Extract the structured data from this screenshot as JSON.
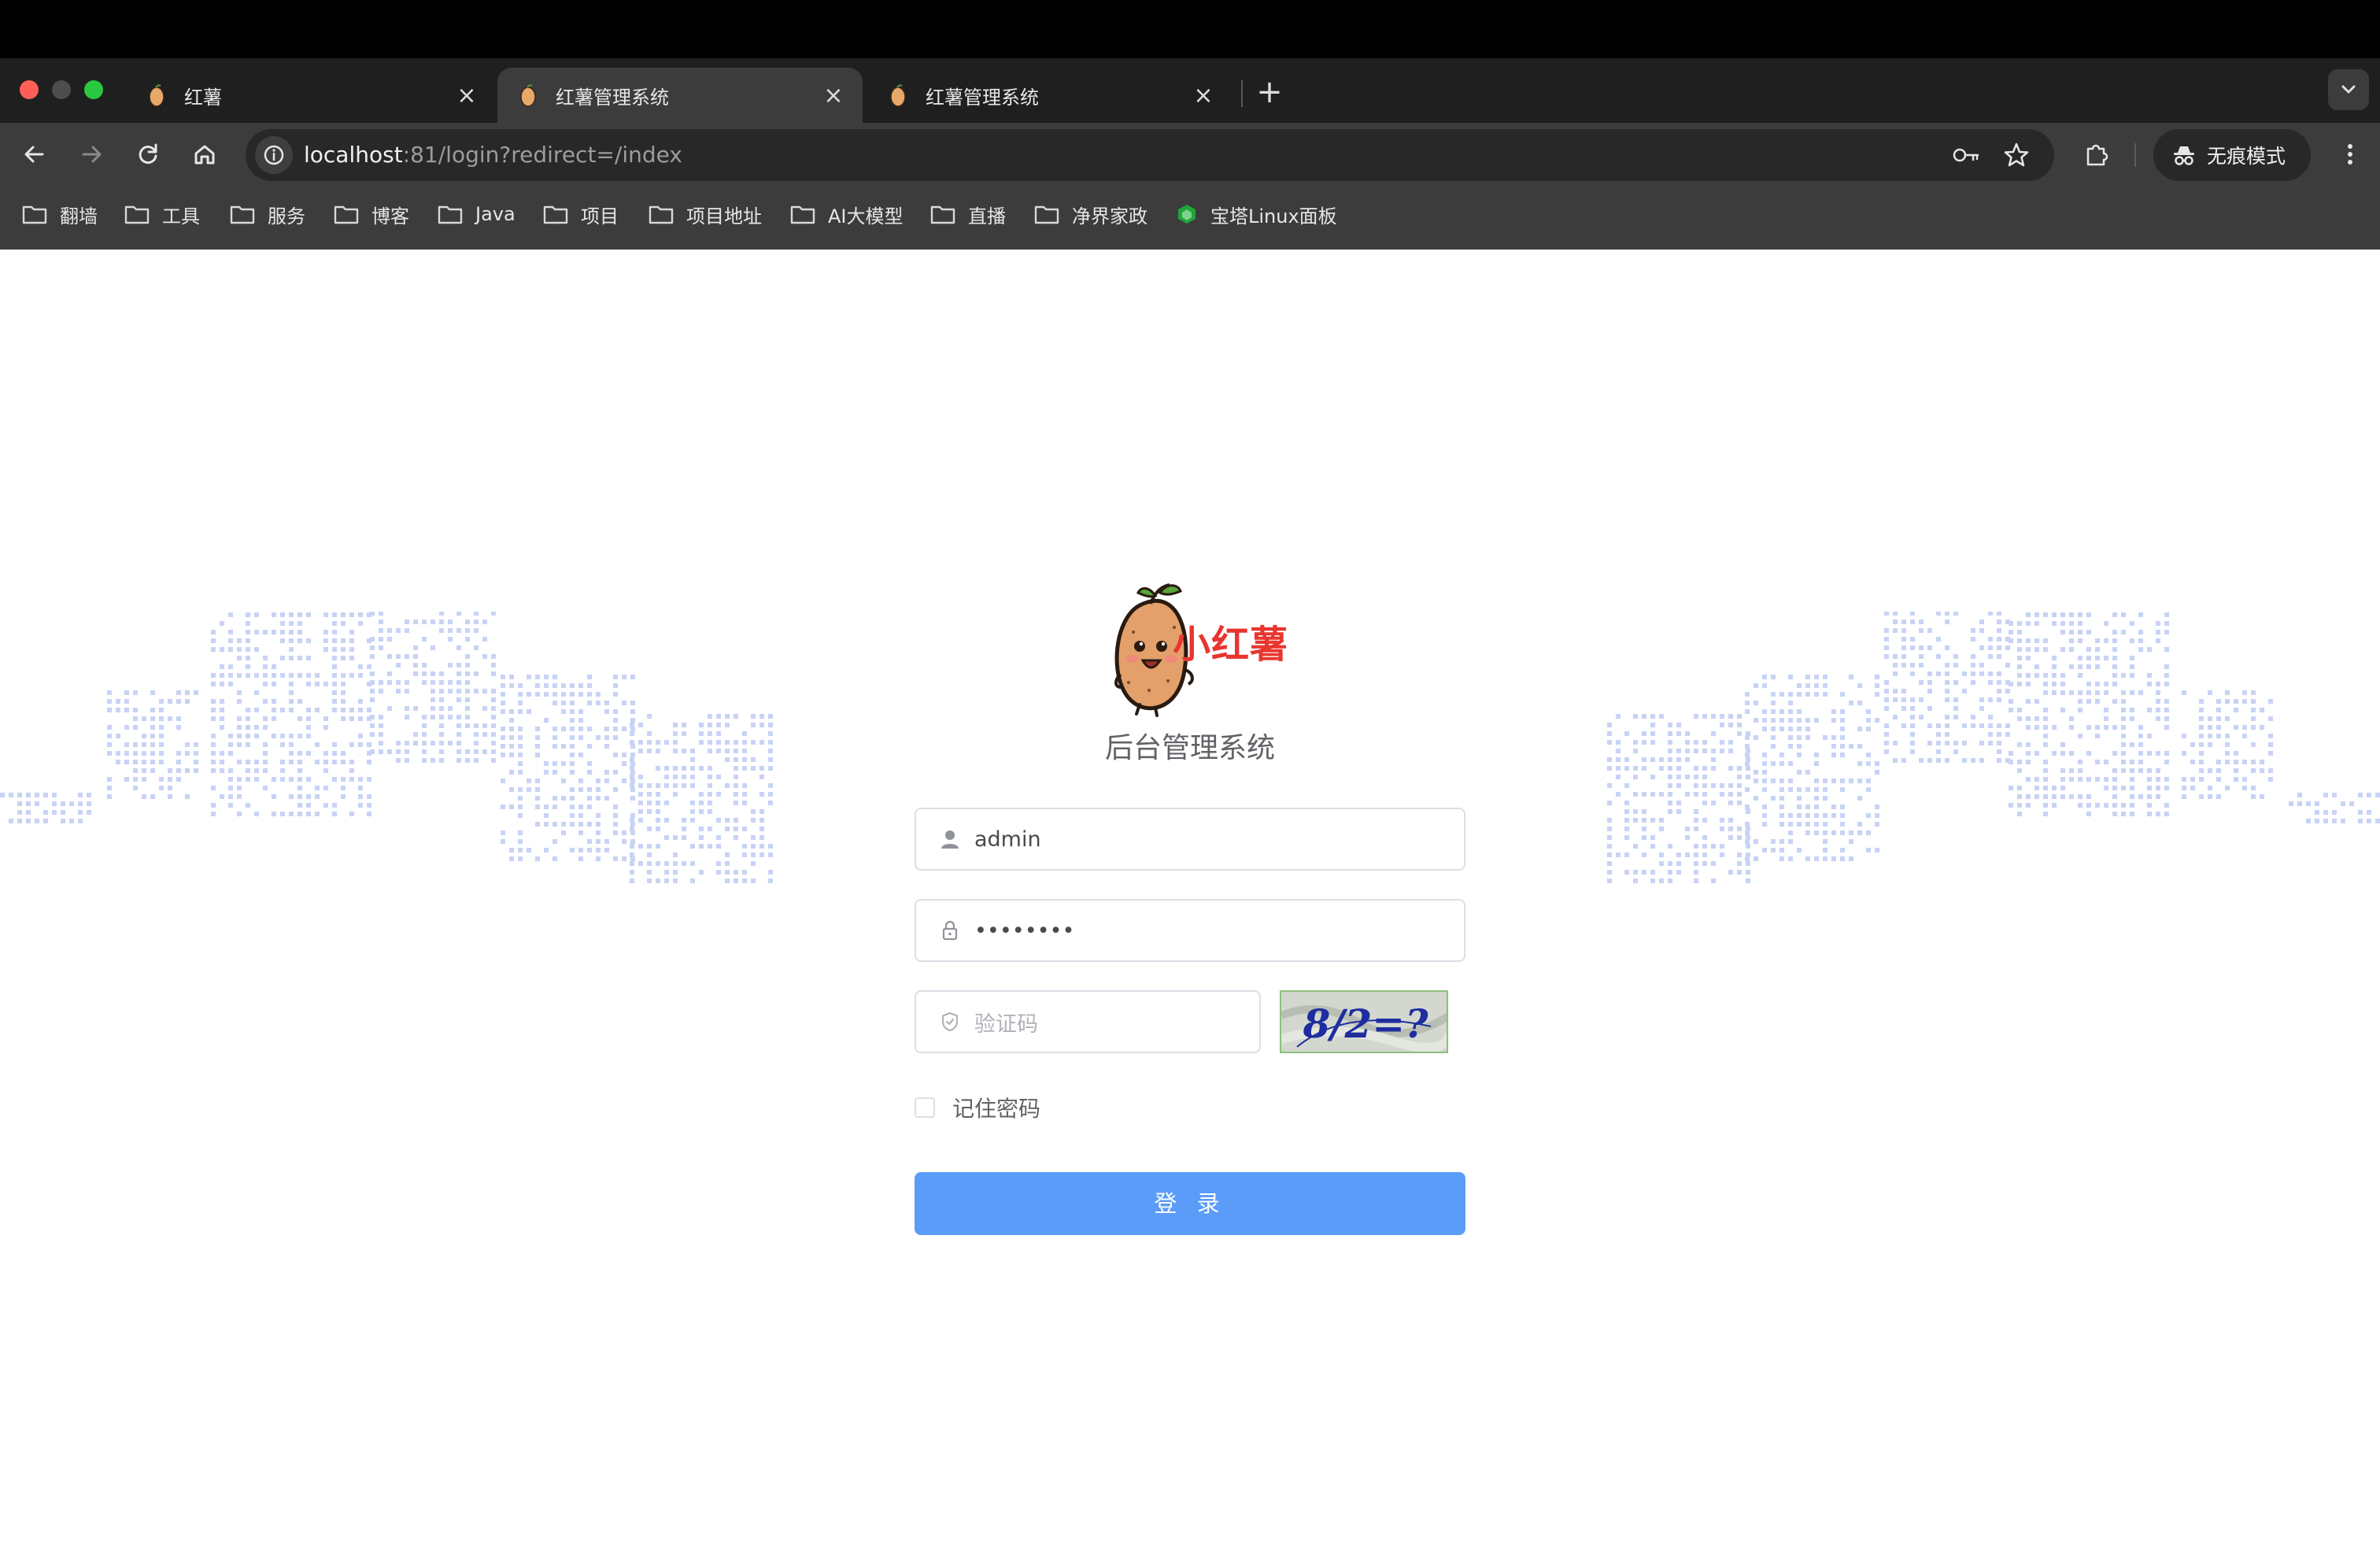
{
  "browser": {
    "tabs": [
      {
        "title": "红薯",
        "active": false
      },
      {
        "title": "红薯管理系统",
        "active": true
      },
      {
        "title": "红薯管理系统",
        "active": false
      }
    ],
    "url": {
      "host": "localhost",
      "rest": ":81/login?redirect=/index"
    },
    "incognito_label": "无痕模式",
    "bookmarks": [
      "翻墙",
      "工具",
      "服务",
      "博客",
      "Java",
      "项目",
      "项目地址",
      "AI大模型",
      "直播",
      "净界家政",
      "宝塔Linux面板"
    ]
  },
  "login": {
    "brand": "小红薯",
    "subtitle": "后台管理系统",
    "username": "admin",
    "password_masked": "••••••••",
    "captcha_placeholder": "验证码",
    "captcha_text": "8/2=?",
    "remember_label": "记住密码",
    "remember_checked": false,
    "submit_label": "登 录"
  },
  "colors": {
    "accent": "#5a9cf8",
    "brand_red": "#e8352f",
    "chrome_dark": "#3c3c3c",
    "city_dots": "#c8d3f5"
  }
}
